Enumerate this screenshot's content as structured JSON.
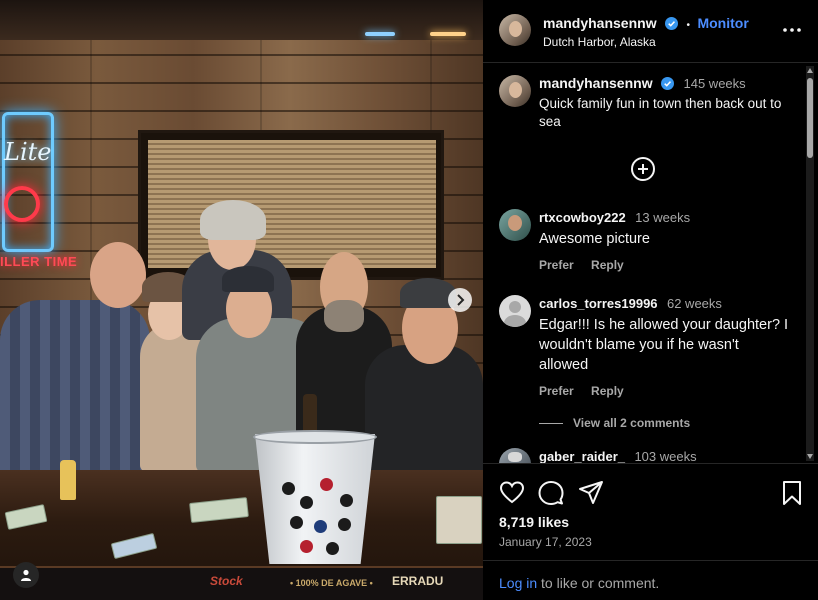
{
  "photo": {
    "neon_word": "Lite",
    "neon_sub": "ILLER TIME",
    "mat_text_left": "Stock",
    "mat_text_mid": "• 100% DE AGAVE •",
    "mat_text_right": "ERRADU"
  },
  "header": {
    "username": "mandyhansennw",
    "separator": "•",
    "follow_label": "Monitor",
    "location": "Dutch Harbor, Alaska"
  },
  "caption": {
    "username": "mandyhansennw",
    "time": "145 weeks",
    "text": "Quick family fun in town then back out to sea"
  },
  "comments": [
    {
      "username": "rtxcowboy222",
      "time": "13 weeks",
      "text": "Awesome picture",
      "like_label": "Prefer",
      "reply_label": "Reply"
    },
    {
      "username": "carlos_torres19996",
      "time": "62 weeks",
      "text": "Edgar!!! Is he allowed your daughter? I wouldn't blame you if he wasn't allowed",
      "like_label": "Prefer",
      "reply_label": "Reply"
    },
    {
      "username": "gaber_raider_",
      "time": "103 weeks"
    }
  ],
  "view_all": "View all 2 comments",
  "likes": "8,719 likes",
  "date": "January 17, 2023",
  "login": {
    "link": "Log in",
    "rest": " to like or comment."
  },
  "colors": {
    "accent": "#4c8dff",
    "verified": "#3897f0",
    "muted": "#a8a8a8",
    "background": "#000000"
  }
}
